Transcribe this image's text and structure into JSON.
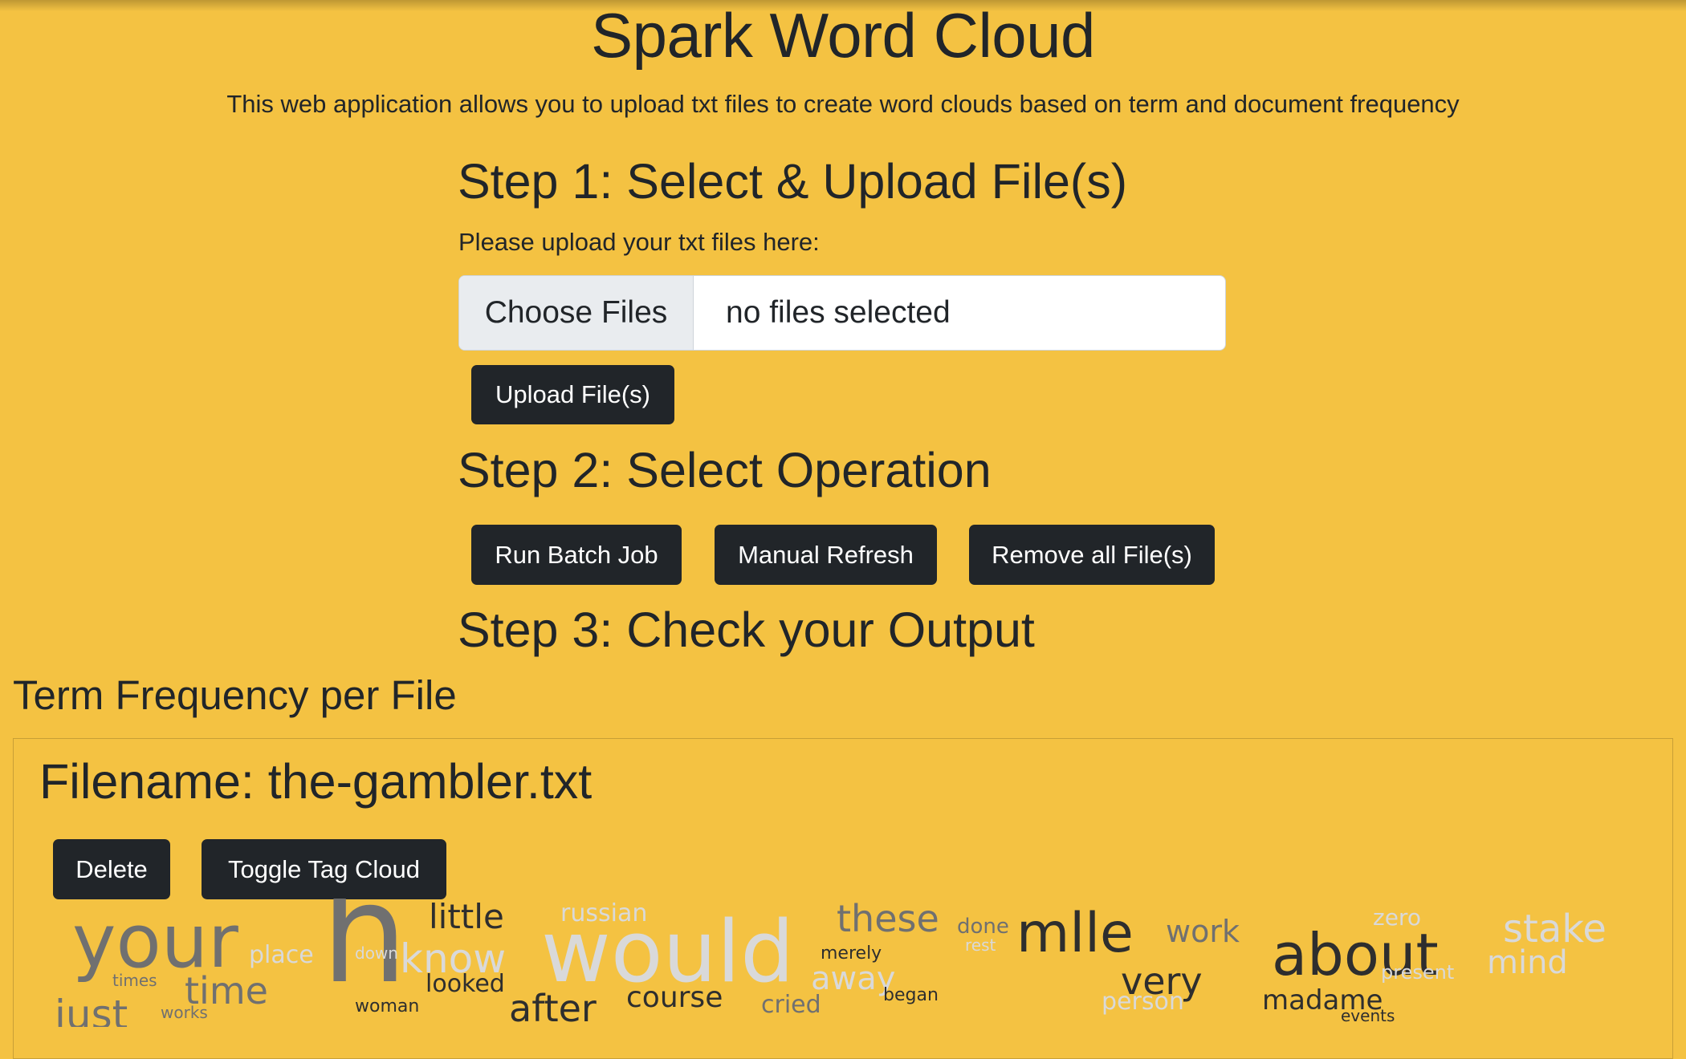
{
  "page": {
    "background": "#f4c242",
    "title": "Spark Word Cloud",
    "subtitle": "This web application allows you to upload txt files to create word clouds based on term and document frequency"
  },
  "step1": {
    "heading": "Step 1: Select & Upload File(s)",
    "label": "Please upload your txt files here:",
    "choose_button": "Choose Files",
    "file_status": "no files selected",
    "upload_button": "Upload File(s)"
  },
  "step2": {
    "heading": "Step 2: Select Operation",
    "buttons": [
      "Run Batch Job",
      "Manual Refresh",
      "Remove all File(s)"
    ]
  },
  "step3": {
    "heading": "Step 3: Check your Output"
  },
  "output": {
    "section_heading": "Term Frequency per File",
    "file_card": {
      "filename": "Filename: the-gambler.txt",
      "delete_button": "Delete",
      "toggle_button": "Toggle Tag Cloud"
    }
  },
  "tag_cloud": {
    "colors": {
      "dark": "#2e2e2e",
      "mid": "#707070",
      "light": "#d9d9d9"
    },
    "words": [
      {
        "text": "your",
        "tone": "mid"
      },
      {
        "text": "place",
        "tone": "light"
      },
      {
        "text": "times",
        "tone": "mid"
      },
      {
        "text": "time",
        "tone": "mid"
      },
      {
        "text": "just",
        "tone": "mid"
      },
      {
        "text": "works",
        "tone": "mid"
      },
      {
        "text": "h",
        "tone": "mid"
      },
      {
        "text": "down",
        "tone": "light"
      },
      {
        "text": "know",
        "tone": "light"
      },
      {
        "text": "little",
        "tone": "dark"
      },
      {
        "text": "looked",
        "tone": "dark"
      },
      {
        "text": "woman",
        "tone": "dark"
      },
      {
        "text": "russian",
        "tone": "light"
      },
      {
        "text": "would",
        "tone": "light"
      },
      {
        "text": "after",
        "tone": "dark"
      },
      {
        "text": "course",
        "tone": "dark"
      },
      {
        "text": "these",
        "tone": "mid"
      },
      {
        "text": "merely",
        "tone": "dark"
      },
      {
        "text": "away",
        "tone": "light"
      },
      {
        "text": "cried",
        "tone": "mid"
      },
      {
        "text": "done",
        "tone": "mid"
      },
      {
        "text": "rest",
        "tone": "light"
      },
      {
        "text": "began",
        "tone": "dark"
      },
      {
        "text": "mlle",
        "tone": "dark"
      },
      {
        "text": "work",
        "tone": "mid"
      },
      {
        "text": "very",
        "tone": "dark"
      },
      {
        "text": "person",
        "tone": "light"
      },
      {
        "text": "about",
        "tone": "dark"
      },
      {
        "text": "madame",
        "tone": "dark"
      },
      {
        "text": "events",
        "tone": "dark"
      },
      {
        "text": "zero",
        "tone": "light"
      },
      {
        "text": "stake",
        "tone": "light"
      },
      {
        "text": "mind",
        "tone": "light"
      },
      {
        "text": "present",
        "tone": "light"
      }
    ]
  }
}
